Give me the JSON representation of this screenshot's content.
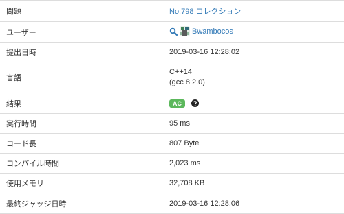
{
  "rows": {
    "problem": {
      "label": "問題",
      "value": "No.798 コレクション"
    },
    "user": {
      "label": "ユーザー",
      "value": "Bwambocos",
      "icon": "search-icon"
    },
    "submitted": {
      "label": "提出日時",
      "value": "2019-03-16 12:28:02"
    },
    "language": {
      "label": "言語",
      "value_line1": "C++14",
      "value_line2": "(gcc 8.2.0)"
    },
    "result": {
      "label": "結果",
      "value": "AC",
      "icon": "question-circle-icon"
    },
    "exec_time": {
      "label": "実行時間",
      "value": "95 ms"
    },
    "code_length": {
      "label": "コード長",
      "value": "807 Byte"
    },
    "compile_time": {
      "label": "コンパイル時間",
      "value": "2,023 ms"
    },
    "memory": {
      "label": "使用メモリ",
      "value": "32,708 KB"
    },
    "last_judge": {
      "label": "最終ジャッジ日時",
      "value": "2019-03-16 12:28:06"
    }
  },
  "colors": {
    "link": "#337ab7",
    "ac_badge": "#5cb85c",
    "border": "#dddddd",
    "text": "#333333"
  }
}
